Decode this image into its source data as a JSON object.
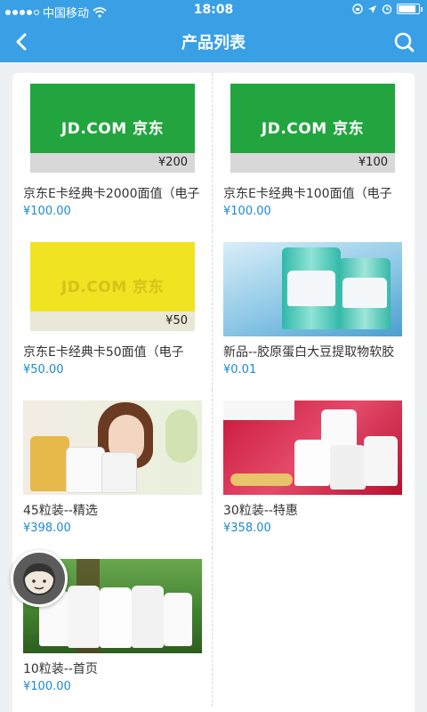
{
  "status_bar": {
    "carrier": "中国移动",
    "time": "18:08"
  },
  "nav": {
    "title": "产品列表"
  },
  "products": [
    {
      "name": "京东E卡经典卡2000面值（电子",
      "price": "¥100.00",
      "card_logo": "JD.COM 京东",
      "card_amount": "¥200"
    },
    {
      "name": "京东E卡经典卡100面值（电子",
      "price": "¥100.00",
      "card_logo": "JD.COM 京东",
      "card_amount": "¥100"
    },
    {
      "name": "京东E卡经典卡50面值（电子",
      "price": "¥50.00",
      "card_logo": "JD.COM 京东",
      "card_amount": "¥50"
    },
    {
      "name": "新品--胶原蛋白大豆提取物软胶",
      "price": "¥0.01"
    },
    {
      "name": "45粒装--精选",
      "price": "¥398.00"
    },
    {
      "name": "30粒装--特惠",
      "price": "¥358.00"
    },
    {
      "name": "10粒装--首页",
      "price": "¥100.00"
    }
  ],
  "colors": {
    "brand_blue": "#3aa0e6",
    "price_blue": "#1a8ad8",
    "jd_green": "#22a53f",
    "jd_yellow": "#f0e321"
  }
}
